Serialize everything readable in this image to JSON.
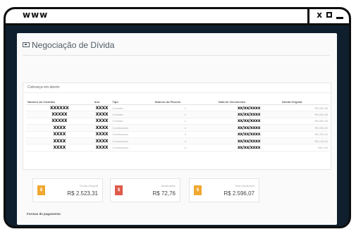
{
  "window": {
    "address_label": "www",
    "close_glyph": "x",
    "icons": [
      "close-icon",
      "maximize-icon",
      "minimize-icon"
    ]
  },
  "page": {
    "title": "Negociação de Dívida",
    "title_icon": "money-icon"
  },
  "debts_panel": {
    "heading": "Cobrança em aberto",
    "columns": [
      "Número do Contrato",
      "Ano",
      "Tipo",
      "Número da Parcela",
      "Data de Vencimento",
      "Dívida Original"
    ],
    "rows": [
      {
        "contract": "XXXXXX",
        "year": "XXXX",
        "type": "Contrato",
        "installment": "1",
        "due": "xx/xx/xxxx",
        "amount": "R$ 530,35"
      },
      {
        "contract": "XXXXX",
        "year": "XXXX",
        "type": "Contrato",
        "installment": "1",
        "due": "xx/xx/xxxx",
        "amount": "R$ 530,35"
      },
      {
        "contract": "XXXXX",
        "year": "XXXX",
        "type": "Contrato",
        "installment": "1",
        "due": "xx/xx/xxxx",
        "amount": "R$ 530,35"
      },
      {
        "contract": "XXXX",
        "year": "XXXX",
        "type": "Confirmation",
        "installment": "2",
        "due": "xx/xx/xxxx",
        "amount": "R$ 290,00"
      },
      {
        "contract": "XXXX",
        "year": "XXXX",
        "type": "Confirmation",
        "installment": "3",
        "due": "xx/xx/xxxx",
        "amount": "R$ 290,00"
      },
      {
        "contract": "XXXX",
        "year": "XXXX",
        "type": "Confirmation",
        "installment": "4",
        "due": "xx/xx/xxxx",
        "amount": "R$ 195,00"
      },
      {
        "contract": "XXXX",
        "year": "XXXX",
        "type": "Confirmation",
        "installment": "5",
        "due": "xx/xx/xxxx",
        "amount": "R$ 0,00"
      }
    ]
  },
  "summary_cards": [
    {
      "label": "Dívida Original",
      "value": "R$ 2.523,31",
      "badge": "$",
      "color": "#f0a830"
    },
    {
      "label": "Atualização",
      "value": "R$ 72,76",
      "badge": "$",
      "color": "#e05a4b"
    },
    {
      "label": "Total Atualizado",
      "value": "R$ 2.596,07",
      "badge": "$",
      "color": "#f0a830"
    }
  ],
  "payment_section": {
    "label": "Formas de pagamento"
  }
}
